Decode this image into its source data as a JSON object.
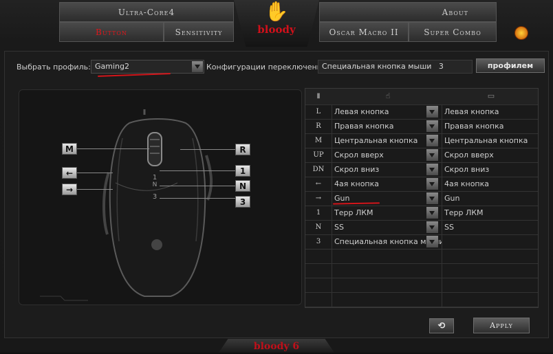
{
  "tabs": {
    "ultra_core": "Ultra-Core4",
    "button": "Button",
    "sensitivity": "Sensitivity",
    "about": "About",
    "oscar_macro": "Oscar Macro II",
    "super_combo": "Super Combo"
  },
  "logo": {
    "text": "bloody"
  },
  "profile": {
    "label": "Выбрать профиль:",
    "value": "Gaming2",
    "switch_label": "Конфигурации переключения :",
    "switch_value": "Специальная кнопка мыши   3",
    "profile_button": "профилем"
  },
  "mouse_keys": {
    "m": "M",
    "r": "R",
    "back": "←",
    "fwd": "→",
    "k1": "1",
    "n": "N",
    "k3": "3"
  },
  "table": {
    "header_icons": [
      "mouse-icon",
      "hand-icon",
      "monitor-icon"
    ],
    "rows": [
      {
        "key": "L",
        "action": "Левая кнопка",
        "result": "Левая кнопка"
      },
      {
        "key": "R",
        "action": "Правая кнопка",
        "result": "Правая кнопка"
      },
      {
        "key": "M",
        "action": "Центральная кнопка",
        "result": "Центральная кнопка"
      },
      {
        "key": "UP",
        "action": "Скрол вверх",
        "result": "Скрол вверх"
      },
      {
        "key": "DN",
        "action": "Скрол вниз",
        "result": "Скрол вниз"
      },
      {
        "key": "←",
        "action": "4ая кнопка",
        "result": "4ая кнопка"
      },
      {
        "key": "→",
        "action": "Gun",
        "result": "Gun"
      },
      {
        "key": "1",
        "action": "Терр ЛКМ",
        "result": "Терр ЛКМ"
      },
      {
        "key": "N",
        "action": "SS",
        "result": "SS"
      },
      {
        "key": "3",
        "action": "Специальная кнопка мыши",
        "result": ""
      }
    ]
  },
  "footer": {
    "reset_icon": "refresh-icon",
    "apply": "Apply",
    "brand": "bloody 6"
  },
  "colors": {
    "accent": "#d3151a",
    "text": "#cfcfcf",
    "panel": "#1c1c1c"
  }
}
